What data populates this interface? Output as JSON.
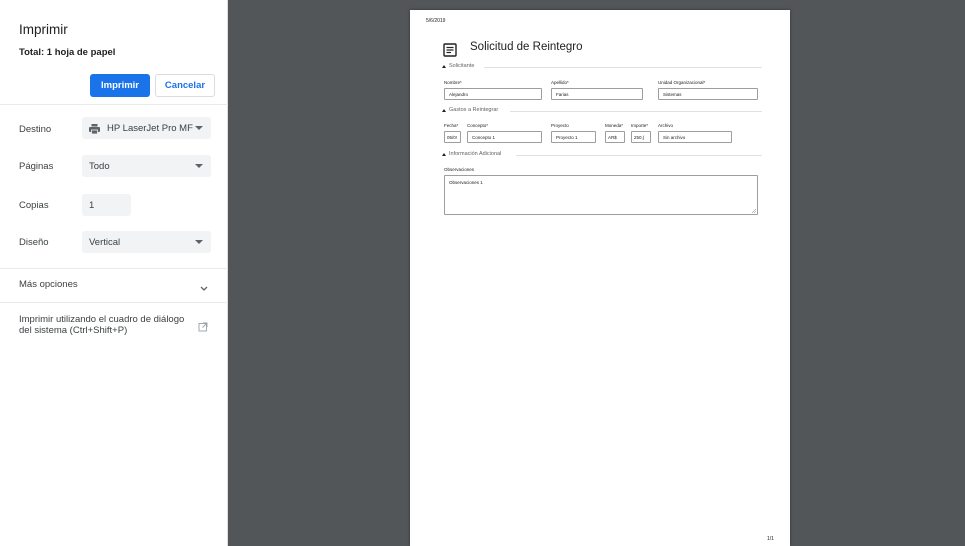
{
  "sidebar": {
    "title": "Imprimir",
    "total": "Total: 1 hoja de papel",
    "print_button": "Imprimir",
    "cancel_button": "Cancelar",
    "destination": {
      "label": "Destino",
      "value": "HP LaserJet Pro MF"
    },
    "pages": {
      "label": "Páginas",
      "value": "Todo"
    },
    "copies": {
      "label": "Copias",
      "value": "1"
    },
    "layout": {
      "label": "Diseño",
      "value": "Vertical"
    },
    "more_options": "Más opciones",
    "system_dialog": "Imprimir utilizando el cuadro de diálogo del sistema (Ctrl+Shift+P)"
  },
  "preview": {
    "date": "5/6/2019",
    "page_number": "1/1",
    "form_title": "Solicitud de Reintegro",
    "sections": {
      "solicitante": {
        "title": "Solicitante",
        "fields": [
          {
            "label": "Nombre*",
            "value": "Alejandro"
          },
          {
            "label": "Apellido*",
            "value": "Farias"
          },
          {
            "label": "Unidad Organizacional*",
            "value": "Sistemas"
          }
        ]
      },
      "gastos": {
        "title": "Gastos a Reintegrar",
        "fields": [
          {
            "label": "Fecha*",
            "value": "05/0!"
          },
          {
            "label": "Concepto*",
            "value": "Concepto 1"
          },
          {
            "label": "Proyecto",
            "value": "Proyecto 1"
          },
          {
            "label": "Moneda*",
            "value": "AR$"
          },
          {
            "label": "Importe*",
            "value": "250,("
          },
          {
            "label": "Archivo",
            "value": "Sin archivo"
          }
        ]
      },
      "info": {
        "title": "Información Adicional",
        "observaciones_label": "Observaciones",
        "observaciones_value": "Observaciones 1"
      }
    }
  }
}
